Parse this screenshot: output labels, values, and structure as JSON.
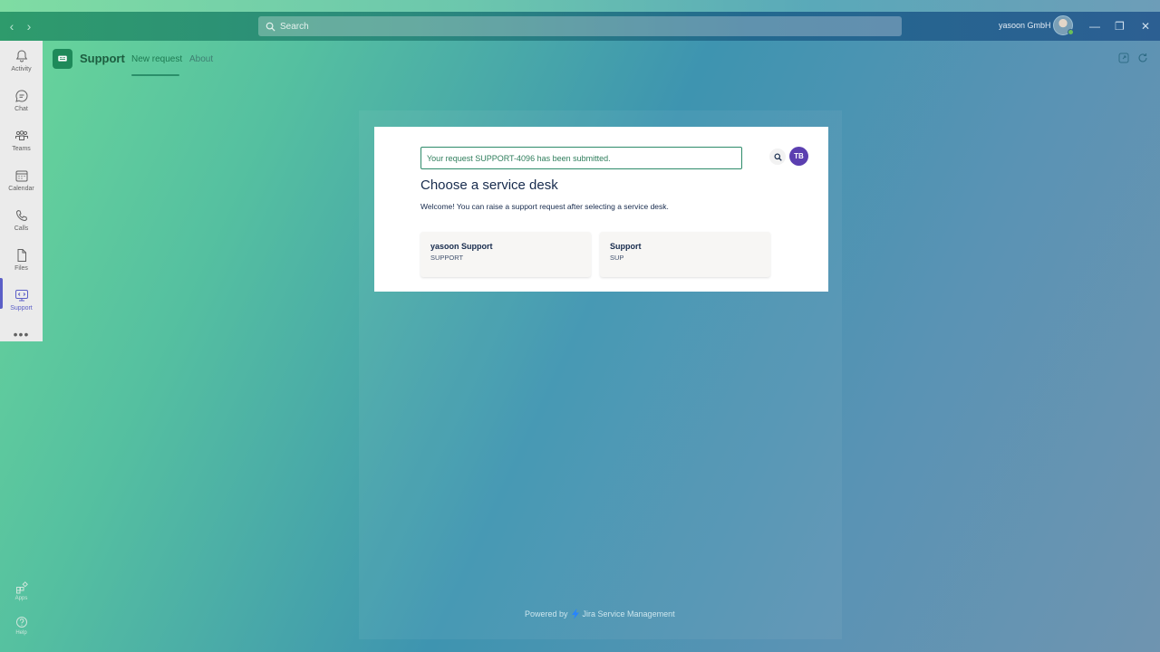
{
  "titlebar": {
    "search_placeholder": "Search",
    "org_name": "yasoon GmbH",
    "back_icon": "‹",
    "forward_icon": "›",
    "minimize": "—",
    "restore": "❐",
    "close": "✕"
  },
  "rail": {
    "items": [
      {
        "label": "Activity",
        "icon": "bell-icon"
      },
      {
        "label": "Chat",
        "icon": "chat-icon"
      },
      {
        "label": "Teams",
        "icon": "teams-icon"
      },
      {
        "label": "Calendar",
        "icon": "calendar-icon"
      },
      {
        "label": "Calls",
        "icon": "phone-icon"
      },
      {
        "label": "Files",
        "icon": "file-icon"
      },
      {
        "label": "Support",
        "icon": "support-icon"
      }
    ],
    "more": "•••",
    "apps_label": "Apps",
    "help_label": "Help",
    "active_color": "#5b5fc7"
  },
  "app": {
    "title": "Support",
    "tabs": [
      {
        "label": "New request"
      },
      {
        "label": "About"
      }
    ]
  },
  "portal": {
    "flag_message": "Your request SUPPORT-4096 has been submitted.",
    "avatar_initials": "TB",
    "title": "Choose a service desk",
    "description": "Welcome! You can raise a support request after selecting a service desk.",
    "desks": [
      {
        "name": "yasoon Support",
        "key": "SUPPORT"
      },
      {
        "name": "Support",
        "key": "SUP"
      }
    ],
    "powered_by": "Powered by",
    "powered_product": "Jira Service Management"
  }
}
